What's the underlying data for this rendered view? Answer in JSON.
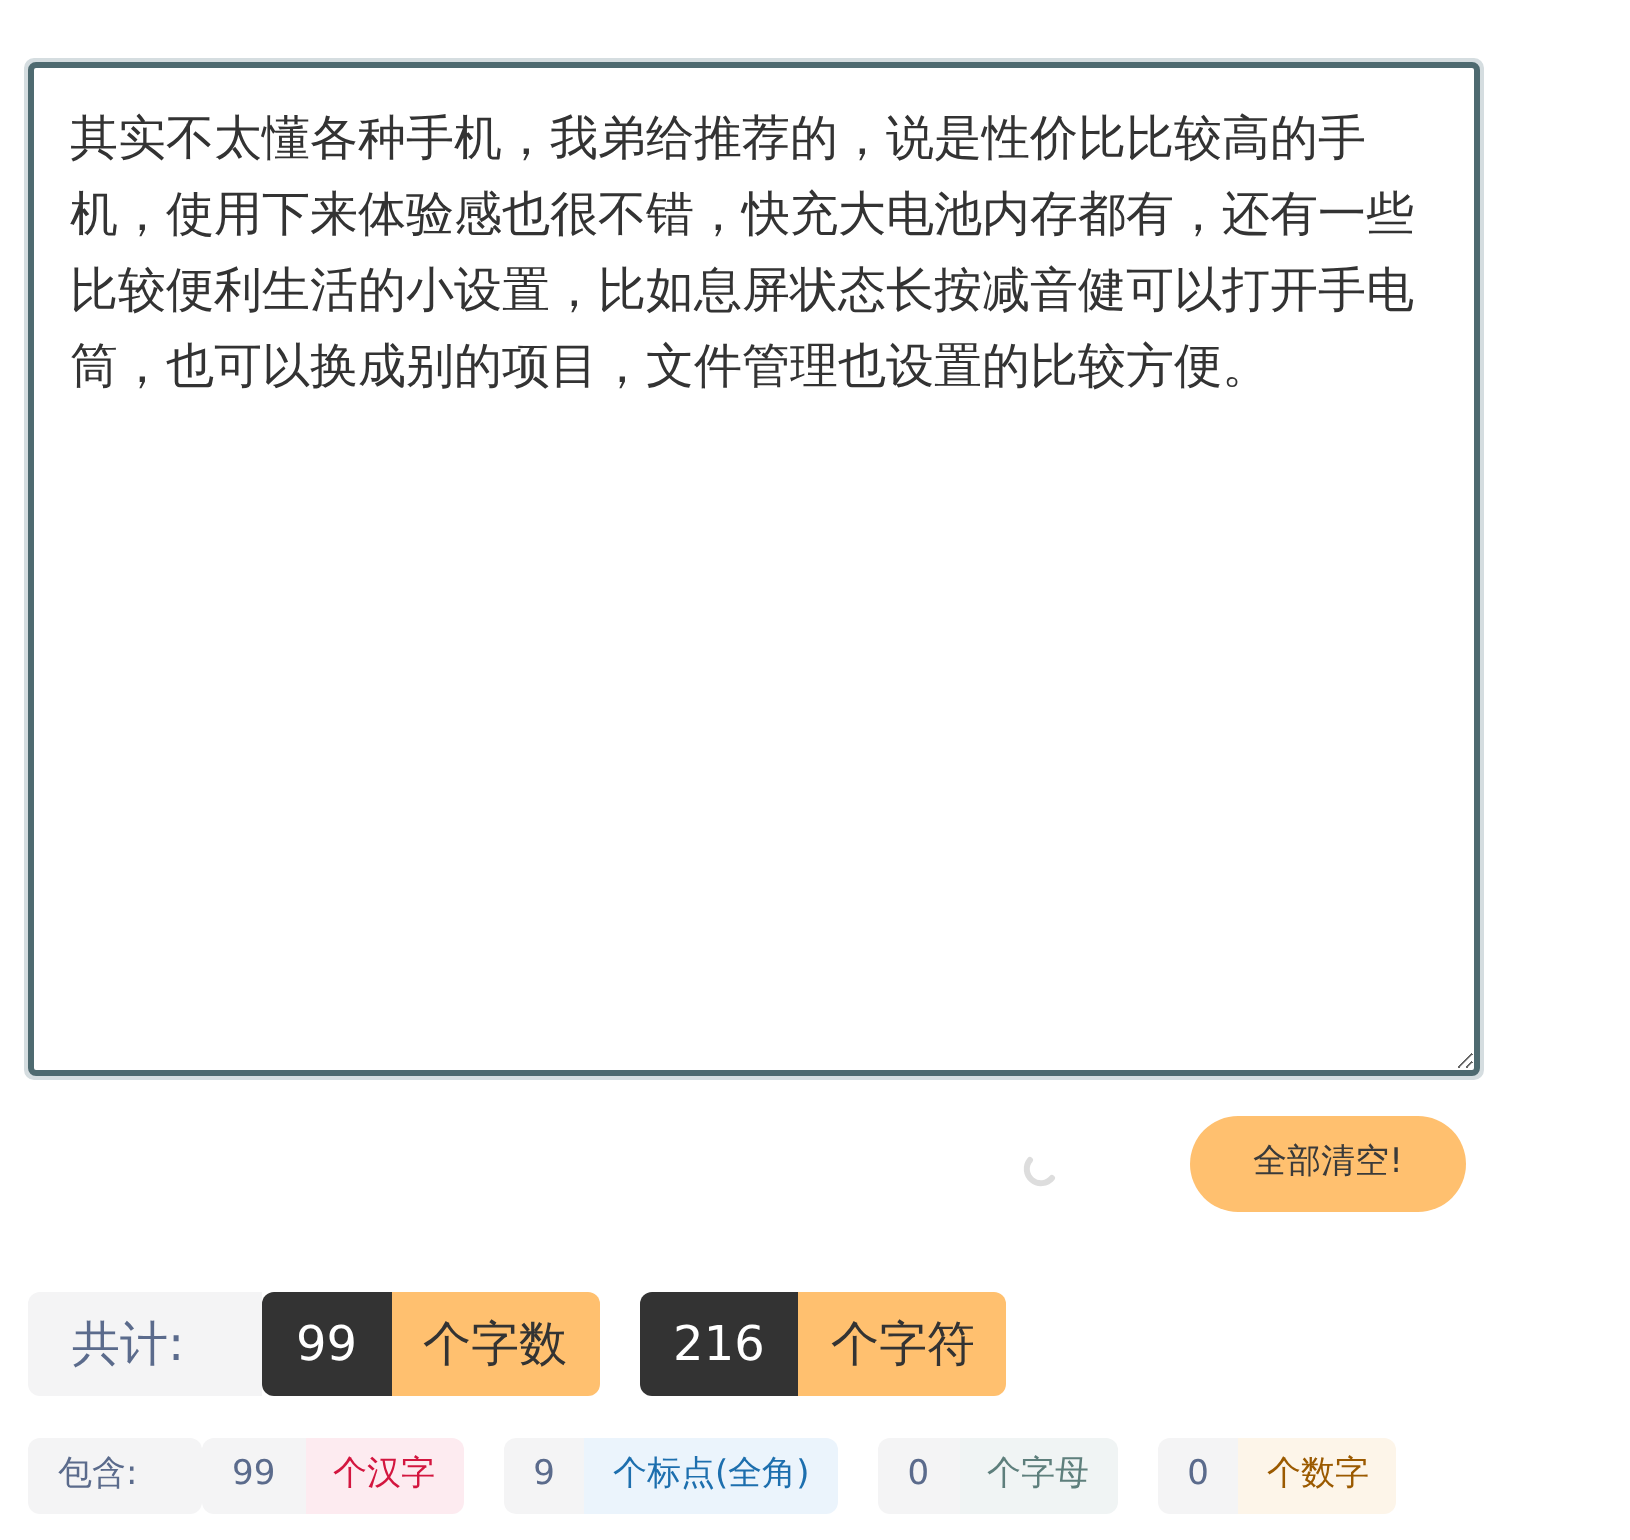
{
  "editor": {
    "value": "其实不太懂各种手机，我弟给推荐的，说是性价比比较高的手机，使用下来体验感也很不错，快充大电池内存都有，还有一些比较便利生活的小设置，比如息屏状态长按减音健可以打开手电筒，也可以换成别的项目，文件管理也设置的比较方便。"
  },
  "clear_button": {
    "label": "全部清空!"
  },
  "totals": {
    "label": "共计:",
    "items": [
      {
        "value": "99",
        "unit": "个字数"
      },
      {
        "value": "216",
        "unit": "个字符"
      }
    ]
  },
  "breakdown": {
    "label": "包含:",
    "items": [
      {
        "kind": "hanzi",
        "value": "99",
        "unit": "个汉字"
      },
      {
        "kind": "punct",
        "value": "9",
        "unit": "个标点(全角)"
      },
      {
        "kind": "letter",
        "value": "0",
        "unit": "个字母"
      },
      {
        "kind": "digit",
        "value": "0",
        "unit": "个数字"
      }
    ]
  }
}
